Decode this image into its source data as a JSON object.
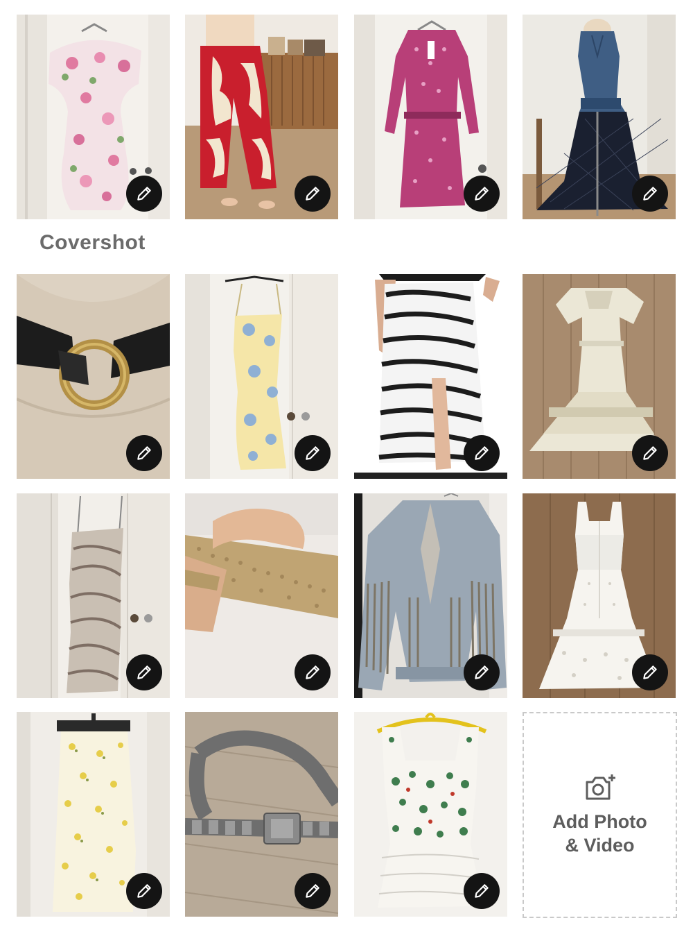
{
  "covershot_label": "Covershot",
  "add_tile": {
    "line1": "Add Photo",
    "line2": "& Video",
    "icon": "camera-plus-icon"
  },
  "edit_icon": "pencil-icon",
  "colors": {
    "edit_button_bg": "#141414",
    "label_gray": "#6b6b6b",
    "dashed_border": "#c9c9c9"
  },
  "listing_photos": [
    {
      "name": "photo-floral-ruffle-dress",
      "subject": "floral ruffle off-shoulder dress"
    },
    {
      "name": "photo-red-print-pants",
      "subject": "red and cream print wide-leg pants"
    },
    {
      "name": "photo-pink-print-dress",
      "subject": "pink printed long-sleeve dress"
    },
    {
      "name": "photo-denim-mesh-dress",
      "subject": "denim top with black mesh skirt on dress form"
    },
    {
      "name": "photo-ring-belt",
      "subject": "black leather belt with gold ring"
    },
    {
      "name": "photo-yellow-floral-slip-dress",
      "subject": "pale yellow floral slip dress"
    },
    {
      "name": "photo-zebra-skirt",
      "subject": "zebra print slit midi skirt"
    },
    {
      "name": "photo-cream-tiered-dress",
      "subject": "cream tiered lace maxi dress"
    },
    {
      "name": "photo-zebra-slip-dress",
      "subject": "taupe zebra satin slip dress"
    },
    {
      "name": "photo-gold-clutch",
      "subject": "gold chainmail clutch bag"
    },
    {
      "name": "photo-fringe-denim-jacket",
      "subject": "fringe denim jacket"
    },
    {
      "name": "photo-white-eyelet-dress",
      "subject": "white eyelet maxi dress"
    },
    {
      "name": "photo-yellow-floral-skirt",
      "subject": "yellow floral satin skirt"
    },
    {
      "name": "photo-silver-concho-belt",
      "subject": "silver concho link belt"
    },
    {
      "name": "photo-green-print-top",
      "subject": "green print lace-hem top on yellow hanger"
    }
  ]
}
